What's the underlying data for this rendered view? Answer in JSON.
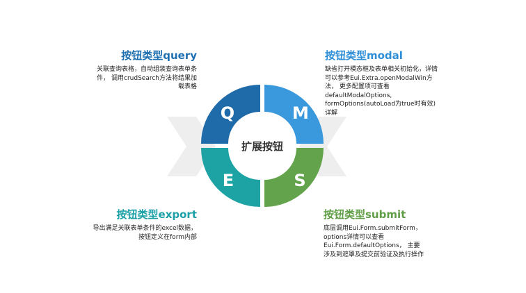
{
  "colors": {
    "q": "#1f6aa8",
    "m": "#3a98dc",
    "e": "#1ea3a5",
    "s": "#63a34c",
    "band": "#eeeeee"
  },
  "center": {
    "label": "扩展按钮"
  },
  "quadrants": {
    "q": "Q",
    "m": "M",
    "e": "E",
    "s": "S"
  },
  "blocks": {
    "query": {
      "title": "按钮类型query",
      "lines": [
        "关联查询表格，自动组装查询表单条",
        "件， 调用crudSearch方法将结果加",
        "载表格"
      ]
    },
    "modal": {
      "title": "按钮类型modal",
      "lines": [
        "缺省打开模态框及表单相关初始化，详情",
        "可以参考Eui.Extra.openModalWin方",
        "法， 更多配置项可查看",
        "defaultModalOptions,",
        "formOptions(autoLoad为true时有效)",
        "详解"
      ]
    },
    "export": {
      "title": "按钮类型export",
      "lines": [
        "导出满足关联表单条件的excel数据，",
        "按钮定义在form内部"
      ]
    },
    "submit": {
      "title": "按钮类型submit",
      "lines": [
        "底层调用Eui.Form.submitForm，",
        "options详情可以查看",
        "Eui.Form.defaultOptions， 主要",
        "涉及到遮罩及提交前验证及执行操作"
      ]
    }
  }
}
